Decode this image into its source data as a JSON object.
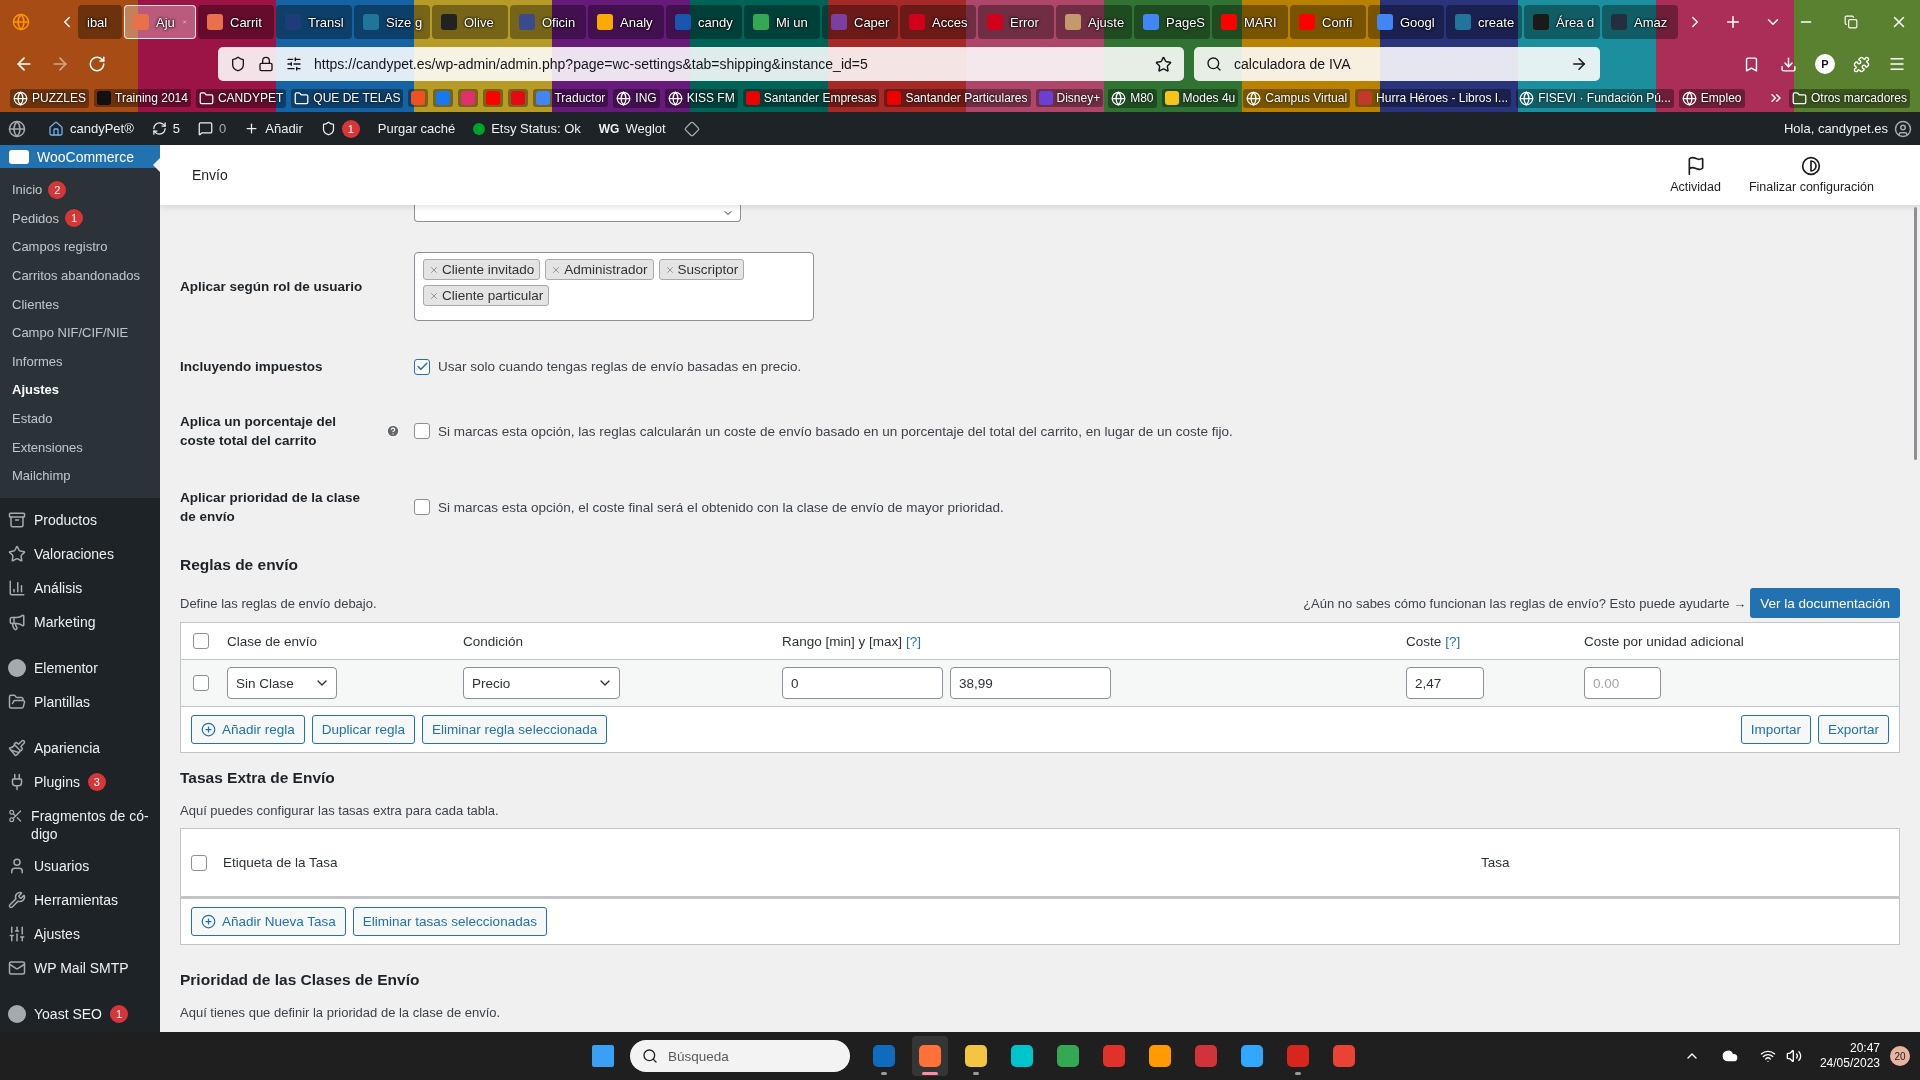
{
  "browser": {
    "tabs": [
      {
        "title": "ibal",
        "selected": false
      },
      {
        "title": "Aju",
        "selected": true,
        "color": "#e8704a"
      },
      {
        "title": "Carrit",
        "selected": false,
        "color": "#e8704a"
      },
      {
        "title": "Transl",
        "selected": false,
        "color": "#1d3c78"
      },
      {
        "title": "Size g",
        "selected": false,
        "color": "#21759b"
      },
      {
        "title": "Olive",
        "selected": false,
        "color": "#222222"
      },
      {
        "title": "Oficin",
        "selected": false,
        "color": "#3b4a8c"
      },
      {
        "title": "Analy",
        "selected": false,
        "color": "#f9ab00"
      },
      {
        "title": "candy",
        "selected": false,
        "color": "#1a56b0"
      },
      {
        "title": "Mi un",
        "selected": false,
        "color": "#34a853"
      },
      {
        "title": "Caper",
        "selected": false,
        "color": "#7b3fa0"
      },
      {
        "title": "Acces",
        "selected": false,
        "color": "#d0021b"
      },
      {
        "title": "Error",
        "selected": false,
        "color": "#d0021b"
      },
      {
        "title": "Ajuste",
        "selected": false,
        "color": "#c49a6c"
      },
      {
        "title": "PageS",
        "selected": false,
        "color": "#4285f4"
      },
      {
        "title": "MARI",
        "selected": false,
        "color": "#ff0000"
      },
      {
        "title": "Confi",
        "selected": false,
        "color": "#ff0000"
      },
      {
        "title": "Googl",
        "selected": false,
        "color": "#4285f4"
      },
      {
        "title": "create",
        "selected": false,
        "color": "#21759b"
      },
      {
        "title": "Área d",
        "selected": false,
        "color": "#1a1a1a"
      },
      {
        "title": "Amaz",
        "selected": false,
        "color": "#232f3e"
      }
    ],
    "url": "https://candypet.es/wp-admin/admin.php?page=wc-settings&tab=shipping&instance_id=5",
    "search": "calculadora de IVA",
    "profile_initial": "P",
    "bookmarks": [
      {
        "label": "PUZZLES",
        "kind": "globe"
      },
      {
        "label": "Training 2014",
        "kind": "site",
        "color": "#111111"
      },
      {
        "label": "CANDYPET",
        "kind": "folder"
      },
      {
        "label": "QUE DE TELAS",
        "kind": "folder"
      },
      {
        "kind": "site",
        "color": "#f25022"
      },
      {
        "kind": "site",
        "color": "#1877f2"
      },
      {
        "kind": "site",
        "color": "#e1306c"
      },
      {
        "kind": "site",
        "color": "#ff0000"
      },
      {
        "kind": "site",
        "color": "#e50914"
      },
      {
        "label": "Traductor",
        "kind": "site",
        "color": "#4285f4"
      },
      {
        "label": "ING",
        "kind": "globe"
      },
      {
        "label": "KISS FM",
        "kind": "globe"
      },
      {
        "label": "Santander Empresas",
        "kind": "site",
        "color": "#ec0000"
      },
      {
        "label": "Santander Particulares",
        "kind": "site",
        "color": "#ec0000"
      },
      {
        "label": "Disney+",
        "kind": "site",
        "color": "#6b3fd6"
      },
      {
        "label": "M80",
        "kind": "globe"
      },
      {
        "label": "Modes 4u",
        "kind": "site",
        "color": "#f5c518"
      },
      {
        "label": "Campus Virtual",
        "kind": "globe"
      },
      {
        "label": "Hurra Héroes - Libros I...",
        "kind": "site",
        "color": "#c0392b"
      },
      {
        "label": "FISEVI · Fundación Pú...",
        "kind": "globe"
      },
      {
        "label": "Empleo",
        "kind": "globe"
      }
    ],
    "other_bookmarks": "Otros marcadores"
  },
  "admin_bar": {
    "site": "candyPet®",
    "updates": "5",
    "comments": "0",
    "new": "Añadir",
    "yoast_count": "1",
    "purge": "Purgar caché",
    "etsy": "Etsy Status: Ok",
    "weglot_logo": "WG",
    "weglot": "Weglot",
    "greeting": "Hola, candypet.es"
  },
  "sidebar": {
    "plugin": {
      "label": "WooCommerce",
      "selected": true
    },
    "submenu": [
      {
        "label": "Inicio",
        "badge": "2",
        "selected": false
      },
      {
        "label": "Pedidos",
        "badge": "1",
        "selected": false
      },
      {
        "label": "Campos registro",
        "selected": false
      },
      {
        "label": "Carritos abandonados",
        "selected": false
      },
      {
        "label": "Clientes",
        "selected": false
      },
      {
        "label": "Campo NIF/CIF/NIE",
        "selected": false
      },
      {
        "label": "Informes",
        "selected": false
      },
      {
        "label": "Ajustes",
        "selected": true
      },
      {
        "label": "Estado",
        "selected": false
      },
      {
        "label": "Extensiones",
        "selected": false
      },
      {
        "label": "Mailchimp",
        "selected": false
      }
    ],
    "menu_groups": [
      [
        {
          "label": "Productos",
          "selected": false
        },
        {
          "label": "Valoraciones",
          "selected": false
        },
        {
          "label": "Análisis",
          "selected": false
        },
        {
          "label": "Marketing",
          "selected": false
        }
      ],
      [
        {
          "label": "Elementor",
          "selected": false
        },
        {
          "label": "Plantillas",
          "selected": false
        }
      ],
      [
        {
          "label": "Apariencia",
          "selected": false
        },
        {
          "label": "Plugins",
          "badge": "3",
          "selected": false
        },
        {
          "label": "Fragmentos de có-digo",
          "selected": false
        },
        {
          "label": "Usuarios",
          "selected": false
        },
        {
          "label": "Herramientas",
          "selected": false
        },
        {
          "label": "Ajustes",
          "selected": false
        },
        {
          "label": "WP Mail SMTP",
          "selected": false
        }
      ],
      [
        {
          "label": "Yoast SEO",
          "badge": "1",
          "selected": false
        }
      ]
    ]
  },
  "header": {
    "title": "Envío",
    "actions": [
      {
        "label": "Actividad"
      },
      {
        "label": "Finalizar configuración"
      }
    ]
  },
  "settings": [
    {
      "kind": "select"
    },
    {
      "kind": "tags",
      "label": "Aplicar según rol de usuario",
      "tags": [
        "Cliente invitado",
        "Administrador",
        "Suscriptor",
        "Cliente particular"
      ]
    },
    {
      "kind": "checkbox",
      "label": "Incluyendo impuestos",
      "checked": true,
      "text": "Usar solo cuando tengas reglas de envío basadas en precio."
    },
    {
      "kind": "checkbox",
      "label": "Aplica un porcentaje del coste total del carrito",
      "checked": false,
      "help": true,
      "text": "Si marcas esta opción, las reglas calcularán un coste de envío basado en un porcentaje del total del carrito, en lugar de un coste fijo."
    },
    {
      "kind": "checkbox",
      "label": "Aplicar prioridad de la clase de envío",
      "checked": false,
      "text": "Si marcas esta opción, el coste final será el obtenido con la clase de envío de mayor prioridad."
    }
  ],
  "rules": {
    "title": "Reglas de envío",
    "description": "Define las reglas de envío debajo.",
    "help_text": "¿Aún no sabes cómo funcionan las reglas de envío? Esto puede ayudarte →",
    "doc_button": "Ver la documentación",
    "select_all": false,
    "columns": [
      {
        "label": "Clase de envío"
      },
      {
        "label": "Condición"
      },
      {
        "label": "Rango [min] y [max]",
        "help": "[?]"
      },
      {
        "label": "Coste",
        "help": "[?]"
      },
      {
        "label": "Coste por unidad adicional"
      }
    ],
    "rows": [
      {
        "checked": false,
        "shipping_class": "Sin Clase",
        "condition": "Precio",
        "min": "0",
        "max": "38,99",
        "cost": "2,47",
        "extra_placeholder": "0.00"
      }
    ],
    "buttons": [
      {
        "label": "Añadir regla",
        "kind": "add"
      },
      {
        "label": "Duplicar regla",
        "kind": "plain"
      },
      {
        "label": "Eliminar regla seleccionada",
        "kind": "plain"
      }
    ],
    "right_buttons": [
      {
        "label": "Importar",
        "kind": "plain"
      },
      {
        "label": "Exportar",
        "kind": "plain"
      }
    ]
  },
  "fees": {
    "title": "Tasas Extra de Envío",
    "description": "Aquí puedes configurar las tasas extra para cada tabla.",
    "select_all": false,
    "columns": [
      "Etiqueta de la Tasa",
      "Tasa"
    ],
    "buttons": [
      {
        "label": "Añadir Nueva Tasa",
        "kind": "add"
      },
      {
        "label": "Eliminar tasas seleccionadas",
        "kind": "plain"
      }
    ]
  },
  "priority": {
    "title": "Prioridad de las Clases de Envío",
    "description": "Aquí tienes que definir la prioridad de la clase de envío."
  },
  "taskbar": {
    "search_placeholder": "Búsqueda",
    "apps": [
      {
        "color": "#0f6cbd",
        "open": true,
        "selected": false
      },
      {
        "color": "#ff7139",
        "open": true,
        "selected": true
      },
      {
        "color": "#f4c542",
        "open": true,
        "selected": false
      },
      {
        "color": "#00c4cc",
        "open": false,
        "selected": false
      },
      {
        "color": "#34a853",
        "open": false,
        "selected": false
      },
      {
        "color": "#e0312b",
        "open": false,
        "selected": false
      },
      {
        "color": "#ff9a00",
        "open": false,
        "selected": false
      },
      {
        "color": "#d13438",
        "open": false,
        "selected": false
      },
      {
        "color": "#31a8ff",
        "open": false,
        "selected": false
      },
      {
        "color": "#d8261c",
        "open": true,
        "selected": false
      },
      {
        "color": "#ea4335",
        "open": false,
        "selected": false
      }
    ],
    "time": "20:47",
    "date": "24/05/2023",
    "notifications": "20"
  }
}
